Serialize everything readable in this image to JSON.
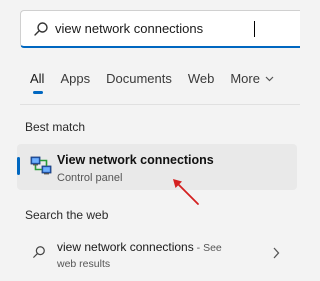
{
  "search": {
    "value": "view network connections",
    "accent": "#0067c0"
  },
  "tabs": [
    {
      "label": "All",
      "active": true
    },
    {
      "label": "Apps"
    },
    {
      "label": "Documents"
    },
    {
      "label": "Web"
    },
    {
      "label": "More",
      "icon": "chevron-down-icon"
    }
  ],
  "best_match": {
    "section_title": "Best match",
    "title": "View network connections",
    "subtitle": "Control panel",
    "icon": "network-connections-icon"
  },
  "web": {
    "section_title": "Search the web",
    "query": "view network connections",
    "see_suffix": " - See",
    "sub": "web results",
    "icon": "search-icon"
  },
  "annotation": {
    "arrow_color": "#d42020"
  }
}
